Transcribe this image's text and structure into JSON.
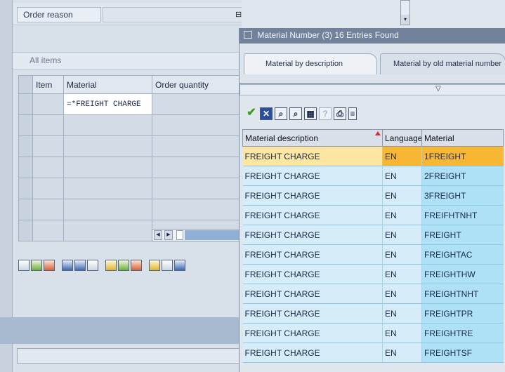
{
  "header": {
    "order_reason_label": "Order reason",
    "dropdown_glyph": "▾"
  },
  "items": {
    "section_label": "All items",
    "columns": [
      "Item",
      "Material",
      "Order quantity"
    ],
    "entry_material": "=*FREIGHT CHARGE",
    "scroll_left": "◀",
    "scroll_right": "▶"
  },
  "popup": {
    "title": "Material Number (3)   16 Entries Found",
    "tabs": [
      "Material by description",
      "Material by old material number"
    ],
    "toolbar_icons": [
      "check-icon",
      "cancel-icon",
      "find-icon",
      "find-next-icon",
      "select-all-icon",
      "help-icon",
      "print-icon",
      "settings-icon"
    ],
    "results": {
      "columns": [
        "Material description",
        "Language",
        "Material"
      ],
      "rows": [
        [
          "FREIGHT CHARGE",
          "EN",
          "1FREIGHT"
        ],
        [
          "FREIGHT CHARGE",
          "EN",
          "2FREIGHT"
        ],
        [
          "FREIGHT CHARGE",
          "EN",
          "3FREIGHT"
        ],
        [
          "FREIGHT CHARGE",
          "EN",
          "FREIFHTNHT"
        ],
        [
          "FREIGHT CHARGE",
          "EN",
          "FREIGHT"
        ],
        [
          "FREIGHT CHARGE",
          "EN",
          "FREIGHTAC"
        ],
        [
          "FREIGHT CHARGE",
          "EN",
          "FREIGHTHW"
        ],
        [
          "FREIGHT CHARGE",
          "EN",
          "FREIGHTNHT"
        ],
        [
          "FREIGHT CHARGE",
          "EN",
          "FREIGHTPR"
        ],
        [
          "FREIGHT CHARGE",
          "EN",
          "FREIGHTRE"
        ],
        [
          "FREIGHT CHARGE",
          "EN",
          "FREIGHTSF"
        ]
      ]
    }
  },
  "colors": {
    "highlight": "#f7b733",
    "row_bg": "#d6ecf8",
    "title_bar": "#73829b"
  }
}
